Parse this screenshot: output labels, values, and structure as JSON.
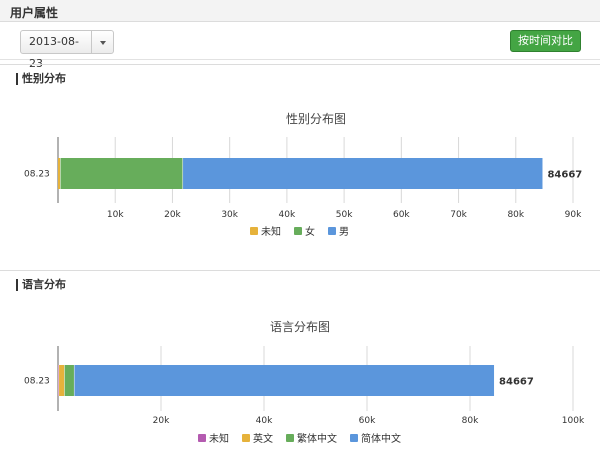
{
  "header": {
    "title": "用户属性"
  },
  "toolbar": {
    "date_value": "2013-08-23",
    "date_picker_icon": "chevron-down-icon",
    "compare_button_label": "按时间对比",
    "compare_button_color": "#44a544"
  },
  "sections": {
    "gender": {
      "heading": "性别分布"
    },
    "language": {
      "heading": "语言分布"
    }
  },
  "chart_data": [
    {
      "type": "bar",
      "orientation": "horizontal",
      "stacked": true,
      "title": "性别分布图",
      "categories": [
        "08.23"
      ],
      "xlim": [
        0,
        90000
      ],
      "x_ticks": [
        10000,
        20000,
        30000,
        40000,
        50000,
        60000,
        70000,
        80000,
        90000
      ],
      "x_tick_labels": [
        "10k",
        "20k",
        "30k",
        "40k",
        "50k",
        "60k",
        "70k",
        "80k",
        "90k"
      ],
      "grid": true,
      "legend_position": "bottom",
      "total_label": "84667",
      "series": [
        {
          "name": "未知",
          "values": [
            400
          ],
          "color": "#e6b23b"
        },
        {
          "name": "女",
          "values": [
            21400
          ],
          "color": "#67ad5b"
        },
        {
          "name": "男",
          "values": [
            62867
          ],
          "color": "#5b96dc"
        }
      ]
    },
    {
      "type": "bar",
      "orientation": "horizontal",
      "stacked": true,
      "title": "语言分布图",
      "categories": [
        "08.23"
      ],
      "xlim": [
        0,
        100000
      ],
      "x_ticks": [
        20000,
        40000,
        60000,
        80000,
        100000
      ],
      "x_tick_labels": [
        "20k",
        "40k",
        "60k",
        "80k",
        "100k"
      ],
      "grid": true,
      "legend_position": "bottom",
      "total_label": "84667",
      "series": [
        {
          "name": "未知",
          "values": [
            150
          ],
          "color": "#b45bb0"
        },
        {
          "name": "英文",
          "values": [
            1100
          ],
          "color": "#e6b23b"
        },
        {
          "name": "繁体中文",
          "values": [
            1900
          ],
          "color": "#67ad5b"
        },
        {
          "name": "简体中文",
          "values": [
            81517
          ],
          "color": "#5b96dc"
        }
      ]
    }
  ]
}
